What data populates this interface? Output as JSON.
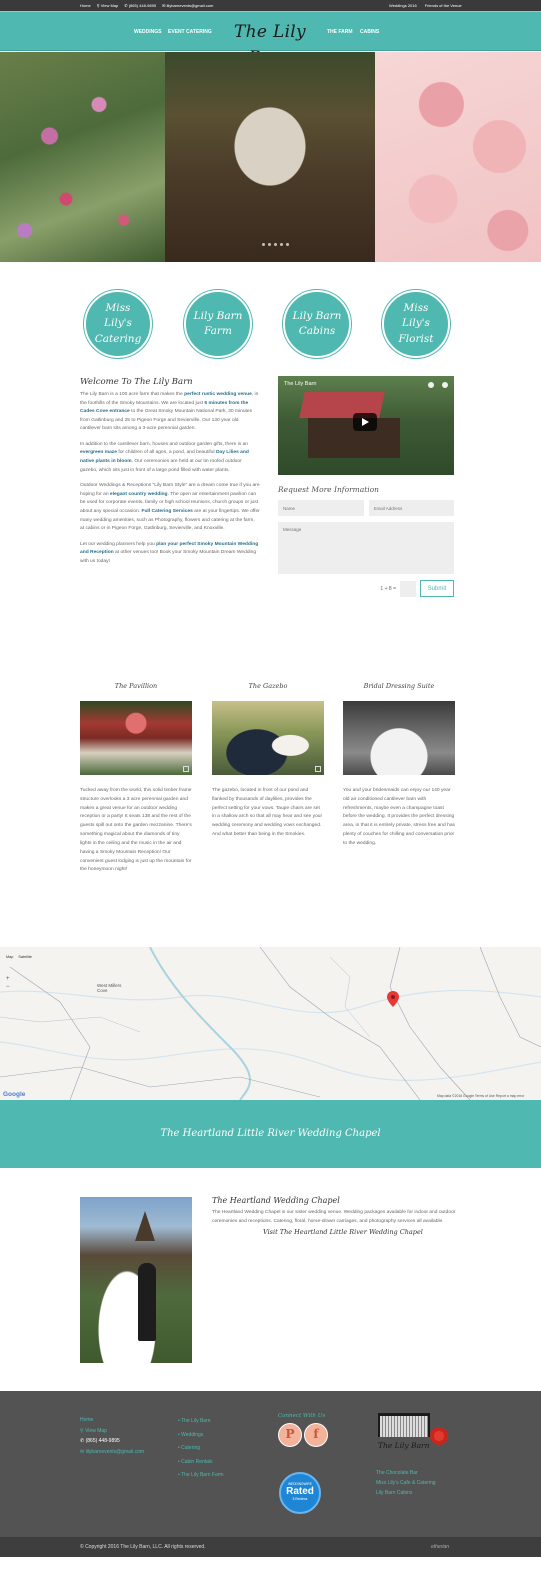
{
  "topbar": {
    "home": "Home",
    "view_map": "View Map",
    "phone": "(865) 448-9895",
    "email": "lilybarnevents@gmail.com",
    "weddings_2016": "Weddings 2016",
    "friends": "Friends of the Venue"
  },
  "nav": {
    "weddings": "WEDDINGS",
    "event_catering": "EVENT CATERING",
    "logo": "The Lily Barn",
    "the_farm": "THE FARM",
    "cabins": "CABINS"
  },
  "circles": [
    {
      "line1": "Miss Lily's",
      "line2": "Catering"
    },
    {
      "line1": "Lily Barn",
      "line2": "Farm"
    },
    {
      "line1": "Lily Barn",
      "line2": "Cabins"
    },
    {
      "line1": "Miss Lily's",
      "line2": "Florist"
    }
  ],
  "welcome": {
    "title": "Welcome To The Lily Barn",
    "p1_a": "The Lily Barn is a 100 acre farm that makes the ",
    "p1_b": "perfect rustic wedding venue",
    "p1_c": ", in the foothills of the Smoky Mountains. We are located just ",
    "p1_d": "5 minutes from the Cades Cove entrance",
    "p1_e": " to the Great Smoky Mountain National Park, 30 minutes from Gatlinburg and 25 to Pigeon Forge and Sevierville. Our 130 year old cantilever barn sits among a 3-acre perennial garden.",
    "p2_a": "In addition to the cantilever barn, houses and outdoor garden gifts, there is an ",
    "p2_b": "evergreen maze",
    "p2_c": " for children of all ages, a pond, and beautiful ",
    "p2_d": "Day Lilies and native plants in bloom",
    "p2_e": ". Our ceremonies are held at our tin roofed outdoor gazebo, which sits just in front of a large pond filled with water plants.",
    "p3_a": "Outdoor Weddings & Receptions \"Lily Barn Style\" are a dream come true if you are hoping for an ",
    "p3_b": "elegant country wedding",
    "p3_c": ". The open air entertainment pavilion can be used for corporate events, family or high school reunions, church groups or just about any special occasion. ",
    "p3_d": "Full Catering Services",
    "p3_e": " are at your fingertips. We offer many wedding amenities, such as Photography, flowers and catering at the farm, at cabins or in Pigeon Forge, Gatlinburg, Sevierville, and Knoxville.",
    "p4_a": "Let our wedding planners help you ",
    "p4_b": "plan your perfect Smoky Mountain Wedding and Reception",
    "p4_c": " at other venues too! Book your Smoky Mountain Dream Wedding with us today!"
  },
  "video": {
    "title": "The Lily Barn"
  },
  "form": {
    "title": "Request More Information",
    "name_placeholder": "Name",
    "email_placeholder": "Email Address",
    "message_placeholder": "Message",
    "captcha": "1 + 8 =",
    "submit": "Submit"
  },
  "features": [
    {
      "title": "The Pavillion",
      "text": "Tucked away from the world, this solid timber frame structure overlooks a 3 acre perennial garden and makes a great venue for an outdoor wedding reception or a party! It seats 138 and the rest of the guests spill out onto the garden mezzanine. There's something magical about the diamonds of tiny lights in the ceiling and the music in the air and having a Smoky Mountain Reception! Our convenient guest lodging is just up the mountain for the honeymoon night!"
    },
    {
      "title": "The Gazebo",
      "text": "The gazebo, located in front of our pond and flanked by thousands of daylilies, provides the perfect setting for your vows. Taupe chairs are set in a shallow arch so that all may hear and see your wedding ceremony and wedding vows exchanged. And what better than being in the Smokies."
    },
    {
      "title": "Bridal Dressing Suite",
      "text": "You and your bridesmaids can enjoy our 140 year old air conditioned cantilever barn with refreshments, maybe even a champagne toast before the wedding. It provides the perfect dressing area, in that it is entirely private, stress free and has plenty of couches for chilling and conversation prior to the wedding."
    }
  ],
  "map": {
    "map_tab": "Map",
    "satellite_tab": "Satellite",
    "zoom_in": "+",
    "zoom_out": "−",
    "town_line1": "West Millers",
    "town_line2": "Cove",
    "google": "Google",
    "credits": "Map data ©2016 Google    Terms of Use    Report a map error"
  },
  "band": {
    "title": "The Heartland Little River Wedding Chapel"
  },
  "chapel": {
    "title": "The Heartland Wedding Chapel",
    "text": "The Heartland Wedding Chapel is our sister wedding venue. Wedding packages available for indoor and outdoor ceremonies and receptions. Catering, floral, horse-drawn carriages, and photography services all available.",
    "visit": "Visit The Heartland Little River Wedding Chapel"
  },
  "footer": {
    "col1": {
      "home": "Home",
      "view_map": "View Map",
      "phone": "(865) 448-9895",
      "email": "lilybarnevents@gmail.com"
    },
    "col2": [
      "The Lily Barn",
      "Weddings",
      "Catering",
      "Cabin Rentals",
      "The Lily Barn Farm"
    ],
    "connect": "Connect With Us",
    "social": [
      {
        "icon": "pinterest-icon",
        "glyph": "P"
      },
      {
        "icon": "facebook-icon",
        "glyph": "f"
      }
    ],
    "badge": {
      "line1": "WEDDINGWIRE",
      "line2": "Rated",
      "line3": "5 Reviews"
    },
    "logo_name": "The Lily Barn",
    "col4": [
      "The Chocolate Bar",
      "Miss Lily's Cafe & Catering",
      "Lily Barn Cabins"
    ]
  },
  "copyright": {
    "text": "© Copyright 2016 The Lily Barn, LLC. All rights reserved.",
    "credit": "etherian"
  },
  "colors": {
    "accent": "#4fb8b0",
    "topbar": "#3a3a3a",
    "footer": "#535353",
    "link": "#2a6d8a"
  }
}
